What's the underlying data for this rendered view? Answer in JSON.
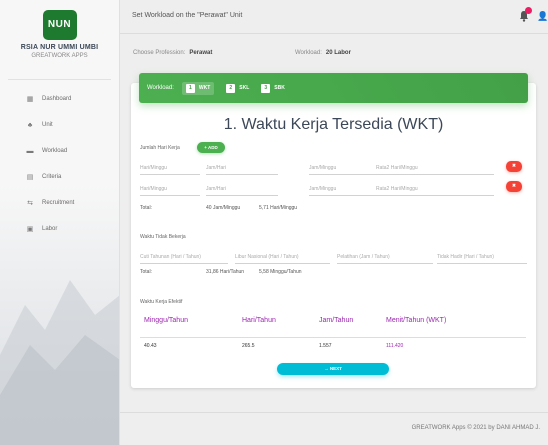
{
  "app": {
    "logo_text": "NUN",
    "brand_name": "RSIA NUR UMMI UMBI",
    "brand_sub": "GREATWORK APPS"
  },
  "sidebar": {
    "items": [
      {
        "label": "Dashboard",
        "icon": "dashboard-icon"
      },
      {
        "label": "Unit",
        "icon": "unit-icon"
      },
      {
        "label": "Workload",
        "icon": "workload-icon"
      },
      {
        "label": "Criteria",
        "icon": "criteria-icon"
      },
      {
        "label": "Recruitment",
        "icon": "recruitment-icon"
      },
      {
        "label": "Labor",
        "icon": "labor-icon"
      }
    ]
  },
  "topbar": {
    "title": "Set Workload on the \"Perawat\" Unit"
  },
  "choose": {
    "profession_label": "Choose Profession:",
    "profession_value": "Perawat",
    "workload_label": "Workload:",
    "workload_value": "20 Labor"
  },
  "card_header": {
    "label": "Workload:",
    "tabs": [
      "WKT",
      "SKL",
      "SBK"
    ]
  },
  "section": {
    "title": "1. Waktu Kerja Tersedia (WKT)"
  },
  "jumlah": {
    "label": "Jumlah Hari Kerja",
    "add_label": "+ ADD",
    "rows": [
      {
        "hari": "Hari/Minggu",
        "jam": "Jam/Hari",
        "jam_minggu": "Jam/Minggu",
        "rata": "Rata2 Hari/Minggu",
        "del": "✖"
      },
      {
        "hari": "Hari/Minggu",
        "jam": "Jam/Hari",
        "jam_minggu": "Jam/Minggu",
        "rata": "Rata2 Hari/Minggu",
        "del": "✖"
      }
    ],
    "total_label": "Total:",
    "total_jam": "40 Jam/Minggu",
    "total_hari": "5,71 Hari/Minggu"
  },
  "tidak_bekerja": {
    "label": "Waktu Tidak Bekerja",
    "fields": [
      "Cuti Tahunan (Hari / Tahun)",
      "Libur Nasional (Hari / Tahun)",
      "Pelatihan (Jam / Tahun)",
      "Tidak Hadir (Hari / Tahun)"
    ],
    "total_label": "Total:",
    "total_hari": "31,86 Hari/Tahun",
    "total_minggu": "5,58 Minggu/Tahun"
  },
  "efektif": {
    "label": "Waktu Kerja Efektif",
    "headers": [
      "Minggu/Tahun",
      "Hari/Tahun",
      "Jam/Tahun",
      "Menit/Tahun (WKT)"
    ],
    "values": [
      "40.43",
      "265.5",
      "1.557",
      "111.420"
    ]
  },
  "next_label": "→ NEXT",
  "footer": {
    "text": "GREATWORK Apps © 2021 by DANI AHMAD J."
  },
  "colors": {
    "green": "#4caf50",
    "red": "#f44336",
    "cyan": "#00bcd4",
    "purple": "#9c27b0"
  }
}
